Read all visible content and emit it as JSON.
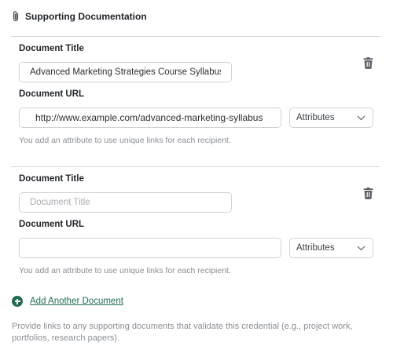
{
  "section": {
    "title": "Supporting Documentation",
    "icon": "paperclip-icon"
  },
  "documents": [
    {
      "title_label": "Document Title",
      "title_value": "Advanced Marketing Strategies Course Syllabus",
      "title_placeholder": "Document Title",
      "url_label": "Document URL",
      "url_value": "http://www.example.com/advanced-marketing-syllabus",
      "url_placeholder": "",
      "attributes_label": "Attributes",
      "helper_text": "You add an attribute to use unique links for each recipient."
    },
    {
      "title_label": "Document Title",
      "title_value": "",
      "title_placeholder": "Document Title",
      "url_label": "Document URL",
      "url_value": "",
      "url_placeholder": "",
      "attributes_label": "Attributes",
      "helper_text": "You add an attribute to use unique links for each recipient."
    }
  ],
  "add_document_label": "Add Another Document",
  "footer_note": "Provide links to any supporting documents that validate this credential (e.g., project work, portfolios, research papers).",
  "colors": {
    "accent": "#1f6b55",
    "text": "#1f2328",
    "muted": "#8a8f95",
    "border": "#cfd3d7"
  }
}
